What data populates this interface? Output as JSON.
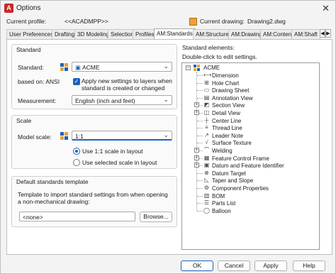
{
  "window": {
    "title": "Options",
    "close": "✕"
  },
  "profile": {
    "current_profile_label": "Current profile:",
    "current_profile_value": "<<ACADMPP>>",
    "current_drawing_label": "Current drawing:",
    "current_drawing_value": "Drawing2.dwg"
  },
  "tabs": [
    "User Preferences",
    "Drafting",
    "3D Modeling",
    "Selection",
    "Profiles",
    "AM:Standards",
    "AM:Structure",
    "AM:Drawing",
    "AM:Content",
    "AM:Shaft"
  ],
  "tab_arrows": {
    "left": "◀",
    "right": "▶"
  },
  "standard_group": {
    "title": "Standard",
    "standard_label": "Standard:",
    "standard_value": "ACME",
    "based_on": "based on: ANSI",
    "apply_checkbox": "Apply new settings to layers when standard is created or changed",
    "apply_checked": true,
    "measurement_label": "Measurement:",
    "measurement_value": "English (inch and feet)"
  },
  "scale_group": {
    "title": "Scale",
    "model_scale_label": "Model scale:",
    "model_scale_value": "1:1",
    "radio_use_1to1": "Use 1:1 scale in layout",
    "radio_use_selected": "Use selected scale in layout",
    "selected_radio": "use_1to1"
  },
  "template_group": {
    "title": "Default standards template",
    "description": "Template to import standard settings from when opening a non-mechanical drawing:",
    "value": "<none>",
    "browse": "Browse..."
  },
  "elements": {
    "title": "Standard elements:",
    "hint": "Double-click to edit settings.",
    "root": "ACME",
    "items": [
      {
        "label": "Dimension",
        "icon": "dimension-icon",
        "expandable": false
      },
      {
        "label": "Hole Chart",
        "icon": "hole-chart-icon",
        "expandable": false
      },
      {
        "label": "Drawing Sheet",
        "icon": "drawing-sheet-icon",
        "expandable": false
      },
      {
        "label": "Annotation View",
        "icon": "annotation-view-icon",
        "expandable": false
      },
      {
        "label": "Section View",
        "icon": "section-view-icon",
        "expandable": true
      },
      {
        "label": "Detail View",
        "icon": "detail-view-icon",
        "expandable": true
      },
      {
        "label": "Center Line",
        "icon": "center-line-icon",
        "expandable": false
      },
      {
        "label": "Thread Line",
        "icon": "thread-line-icon",
        "expandable": false
      },
      {
        "label": "Leader Note",
        "icon": "leader-note-icon",
        "expandable": false
      },
      {
        "label": "Surface Texture",
        "icon": "surface-texture-icon",
        "expandable": false
      },
      {
        "label": "Welding",
        "icon": "welding-icon",
        "expandable": true
      },
      {
        "label": "Feature Control Frame",
        "icon": "feature-control-frame-icon",
        "expandable": true
      },
      {
        "label": "Datum and Feature Identifier",
        "icon": "datum-identifier-icon",
        "expandable": true
      },
      {
        "label": "Datum Target",
        "icon": "datum-target-icon",
        "expandable": false
      },
      {
        "label": "Taper and Slope",
        "icon": "taper-slope-icon",
        "expandable": false
      },
      {
        "label": "Component Properties",
        "icon": "component-properties-icon",
        "expandable": false
      },
      {
        "label": "BOM",
        "icon": "bom-icon",
        "expandable": false
      },
      {
        "label": "Parts List",
        "icon": "parts-list-icon",
        "expandable": false
      },
      {
        "label": "Balloon",
        "icon": "balloon-icon",
        "expandable": false
      }
    ]
  },
  "buttons": {
    "ok": "OK",
    "cancel": "Cancel",
    "apply": "Apply",
    "help": "Help"
  },
  "colors": {
    "accent": "#1e63b8",
    "brand": "#c62828"
  }
}
